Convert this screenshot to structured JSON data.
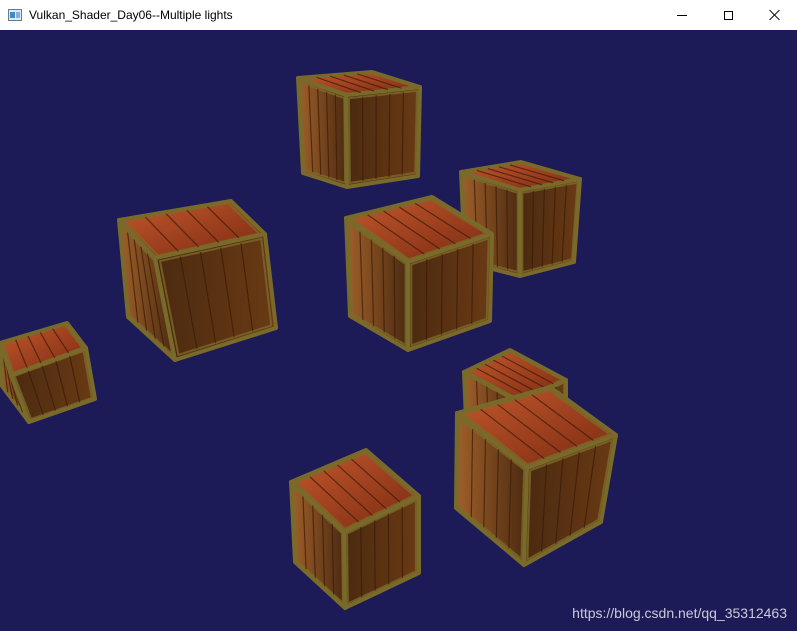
{
  "window": {
    "title": "Vulkan_Shader_Day06--Multiple lights",
    "icons": {
      "app": "app-icon",
      "minimize": "minimize-icon",
      "maximize": "maximize-icon",
      "close": "close-icon"
    }
  },
  "scene": {
    "background_color": "#1d1b57",
    "colors": {
      "wood_top_light": "#c4582c",
      "wood_top_dark": "#7a2a12",
      "wood_side_light": "#a0602a",
      "wood_side_dark": "#4b2a10",
      "frame": "#7a6a2a",
      "grain": "#3a1a08"
    }
  },
  "watermark": "https://blog.csdn.net/qq_35312463"
}
